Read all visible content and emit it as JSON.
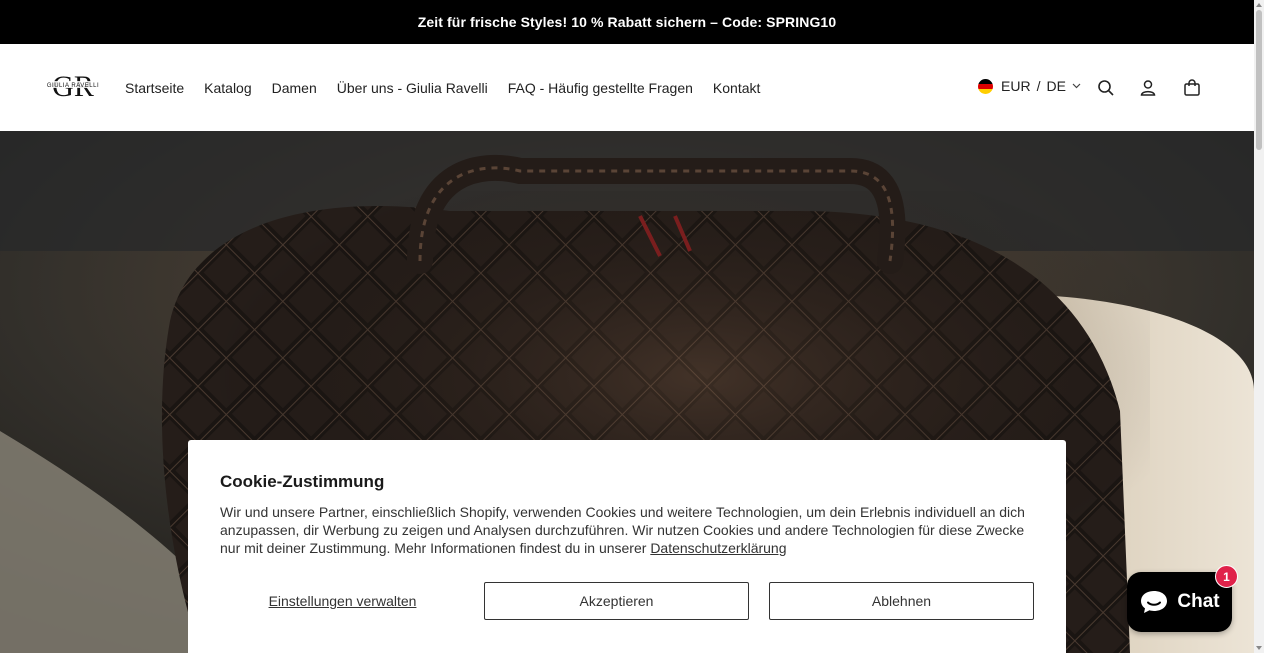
{
  "announcement": {
    "text": "Zeit für frische Styles! 10 % Rabatt sichern – Code: SPRING10"
  },
  "header": {
    "logo_monogram": "GR",
    "logo_text": "GIULIA RAVELLI",
    "nav": [
      {
        "label": "Startseite"
      },
      {
        "label": "Katalog"
      },
      {
        "label": "Damen"
      },
      {
        "label": "Über uns - Giulia Ravelli"
      },
      {
        "label": "FAQ - Häufig gestellte Fragen"
      },
      {
        "label": "Kontakt"
      }
    ],
    "locale": {
      "currency": "EUR",
      "separator": "/",
      "language": "DE"
    },
    "icons": [
      "search-icon",
      "account-icon",
      "cart-icon"
    ]
  },
  "cookie": {
    "title": "Cookie-Zustimmung",
    "body": "Wir und unsere Partner, einschließlich Shopify, verwenden Cookies und weitere Technologien, um dein Erlebnis individuell an dich anzupassen, dir Werbung zu zeigen und Analysen durchzuführen. Wir nutzen Cookies und andere Technologien für diese Zwecke nur mit deiner Zustimmung. Mehr Informationen findest du in unserer ",
    "privacy_link": "Datenschutzerklärung",
    "manage_label": "Einstellungen verwalten",
    "accept_label": "Akzeptieren",
    "decline_label": "Ablehnen"
  },
  "chat": {
    "label": "Chat",
    "badge": "1"
  },
  "colors": {
    "announcement_bg": "#000000",
    "chat_bg": "#000000",
    "badge": "#e0224a"
  }
}
